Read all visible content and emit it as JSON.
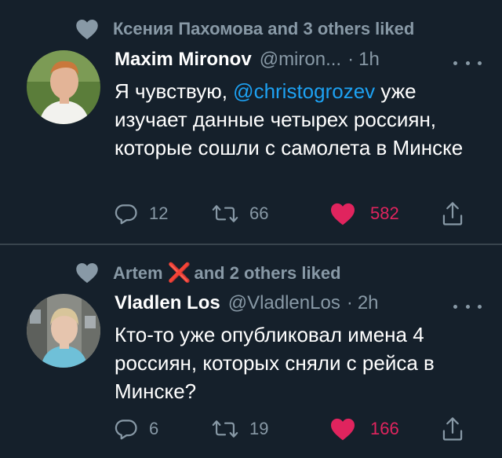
{
  "colors": {
    "background": "#15202b",
    "secondary_text": "#8899a6",
    "link": "#1da1f2",
    "like": "#e0245e",
    "divider": "#38444d"
  },
  "tweets": [
    {
      "social_context": {
        "icon": "heart-icon",
        "text": "Ксения Пахомова and 3 others liked"
      },
      "author_name": "Maxim Mironov",
      "handle": "@miron...",
      "separator": "·",
      "time": "1h",
      "body": {
        "before": "Я чувствую, ",
        "mention": "@christogrozev",
        "after": " уже изучает данные четырех россиян, которые сошли с самолета в Минске"
      },
      "actions": {
        "replies": "12",
        "retweets": "66",
        "likes": "582",
        "liked": true
      }
    },
    {
      "social_context": {
        "icon": "heart-icon",
        "name": "Artem",
        "emoji": "❌",
        "text": "and 2 others liked"
      },
      "author_name": "Vladlen Los",
      "handle": "@VladlenLos",
      "separator": "·",
      "time": "2h",
      "body": {
        "text": "Кто-то уже опубликовал имена 4 россиян, которых сняли с рейса в Минске?"
      },
      "actions": {
        "replies": "6",
        "retweets": "19",
        "likes": "166",
        "liked": true
      }
    }
  ]
}
